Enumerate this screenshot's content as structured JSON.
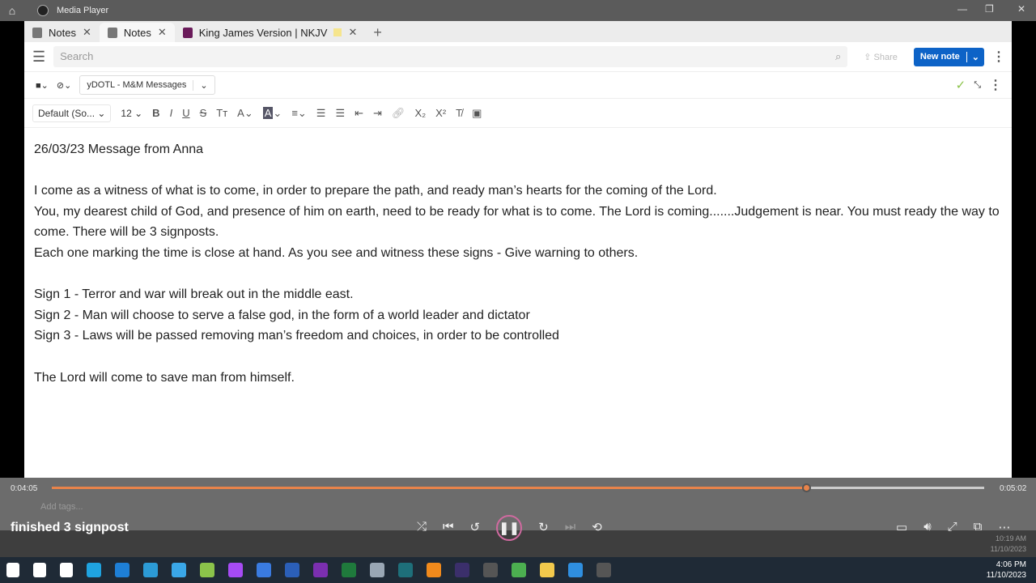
{
  "window": {
    "title": "Media Player"
  },
  "tabs": [
    {
      "label": "Notes"
    },
    {
      "label": "Notes",
      "active": true
    },
    {
      "label": "King James Version | NKJV"
    }
  ],
  "search": {
    "placeholder": "Search"
  },
  "actions": {
    "share": "Share",
    "new_note": "New note"
  },
  "notebook": {
    "name": "yDOTL - M&M Messages"
  },
  "format": {
    "font": "Default (So...",
    "size": "12"
  },
  "note": {
    "lines": [
      "26/03/23 Message from Anna",
      "",
      "I come as a witness of what is to come, in order to prepare the path, and ready man’s hearts for the coming of the Lord.",
      "You, my dearest child of God, and presence of him on earth, need to be ready for what is to come. The Lord is coming.......Judgement is near. You must ready the way to come. There will be 3 signposts.",
      "Each one marking the time is close at hand. As you see and witness these signs - Give warning to others.",
      "",
      "Sign 1 - Terror and war will break out in the middle east.",
      "Sign 2 - Man will choose to serve a false god, in the form of a world leader and dictator",
      "Sign 3 - Laws will be passed removing man’s freedom and choices, in order to be controlled",
      "",
      "The Lord will come to save man from himself."
    ]
  },
  "tags_placeholder": "Add tags...",
  "player": {
    "elapsed": "0:04:05",
    "total": "0:05:02",
    "progress_percent": 81,
    "caption": "finished 3 signpost",
    "accent": "#e8834a"
  },
  "ghost_clock": {
    "time": "10:19 AM",
    "date": "11/10/2023"
  },
  "clock": {
    "time": "4:06 PM",
    "date": "11/10/2023"
  },
  "taskbar_colors": [
    "#ffffff",
    "#ffffff",
    "#ffffff",
    "#1fa3e0",
    "#1e7fd6",
    "#2c9bd6",
    "#3aa7e8",
    "#8bc34a",
    "#a64bf4",
    "#3a7be0",
    "#2b5fb8",
    "#7b2fb0",
    "#1f7a3c",
    "#9aa7b4",
    "#1e6f7a",
    "#f08a1c",
    "#3b2f6b",
    "#555555",
    "#4caf50",
    "#f2c94c",
    "#2f8fe0",
    "#555555"
  ]
}
